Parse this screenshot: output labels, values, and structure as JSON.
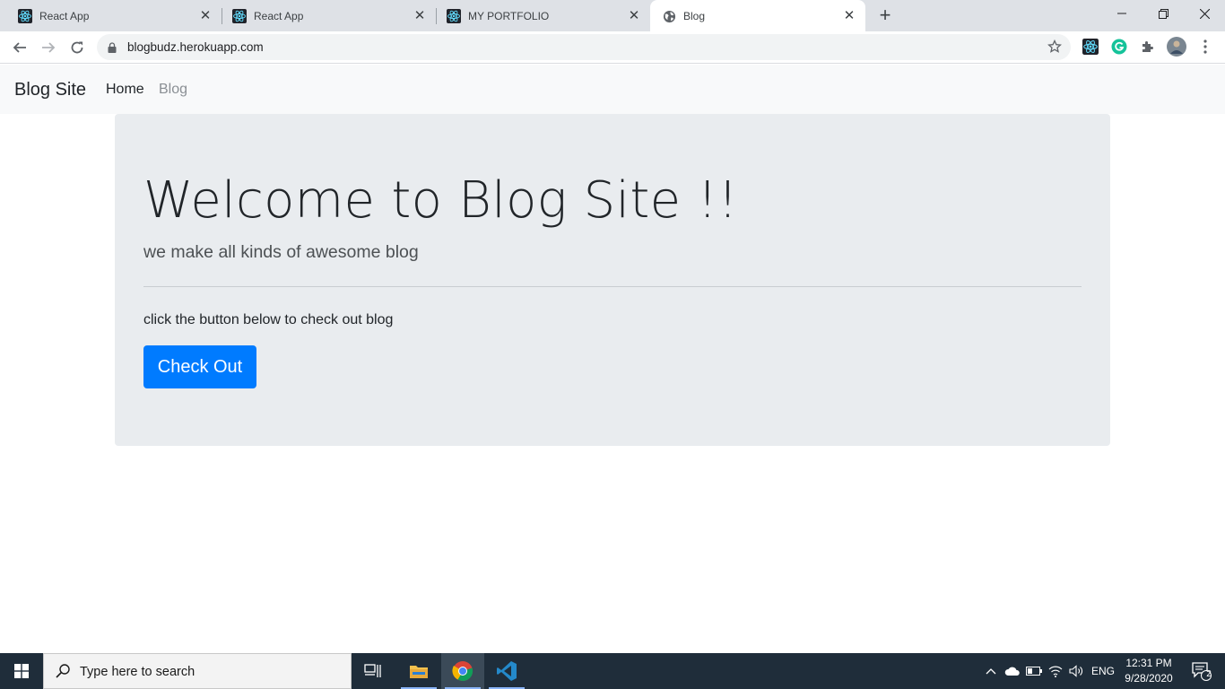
{
  "browser": {
    "tabs": [
      {
        "title": "React App",
        "icon": "react-icon"
      },
      {
        "title": "React App",
        "icon": "react-icon"
      },
      {
        "title": "MY PORTFOLIO",
        "icon": "react-icon"
      },
      {
        "title": "Blog",
        "icon": "globe-icon"
      }
    ],
    "active_tab_index": 3,
    "url": "blogbudz.herokuapp.com"
  },
  "navbar": {
    "brand": "Blog Site",
    "links": [
      {
        "label": "Home",
        "active": true
      },
      {
        "label": "Blog",
        "active": false
      }
    ]
  },
  "jumbotron": {
    "heading": "Welcome to Blog Site !!",
    "lead": "we make all kinds of awesome blog",
    "text": "click the button below to check out blog",
    "button_label": "Check Out"
  },
  "taskbar": {
    "search_placeholder": "Type here to search",
    "language": "ENG",
    "time": "12:31 PM",
    "date": "9/28/2020",
    "notification_count": "2"
  },
  "colors": {
    "primary": "#007bff",
    "jumbotron_bg": "#e9ecef",
    "navbar_bg": "#f8f9fa",
    "taskbar_bg": "#1f2d3a"
  }
}
